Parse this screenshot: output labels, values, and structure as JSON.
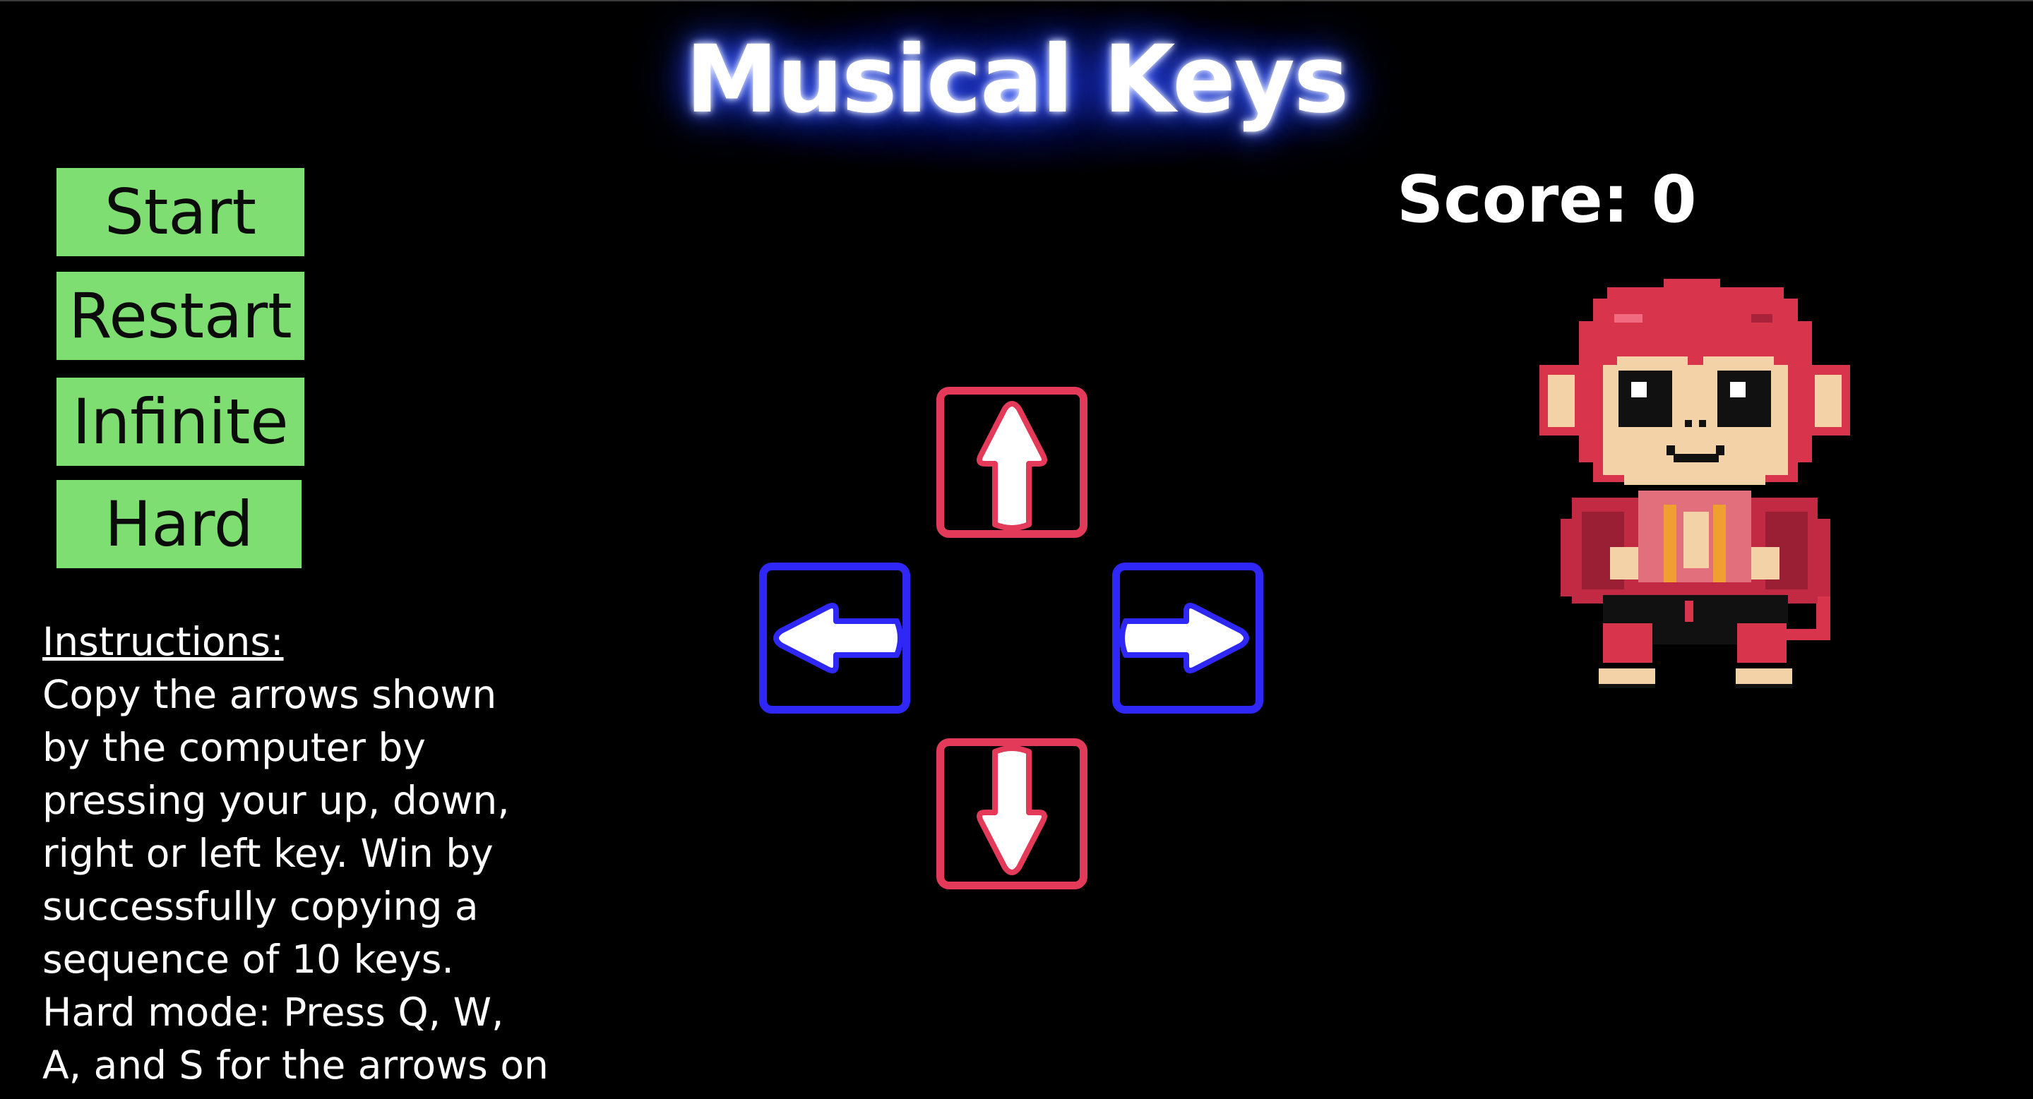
{
  "title": "Musical Keys",
  "menu": {
    "start": "Start",
    "restart": "Restart",
    "infinite": "Infinite",
    "hard": "Hard"
  },
  "instructions": {
    "heading": "Instructions:",
    "body": "Copy the arrows shown by the computer by pressing your up, down, right or left key. Win by successfully copying a sequence of 10 keys. Hard mode: Press Q, W, A, and S for the arrows on the corner."
  },
  "score": {
    "text": "Score: 0"
  },
  "arrows": {
    "up": "arrow-up-icon",
    "down": "arrow-down-icon",
    "left": "arrow-left-icon",
    "right": "arrow-right-icon"
  },
  "colors": {
    "background": "#000000",
    "button_green": "#7ede71",
    "vertical_arrow_border": "#e23a58",
    "horizontal_arrow_border": "#2f27f5",
    "title_glow": "#2545ff",
    "monkey_primary": "#d8344c"
  },
  "character": "pixel-monkey"
}
